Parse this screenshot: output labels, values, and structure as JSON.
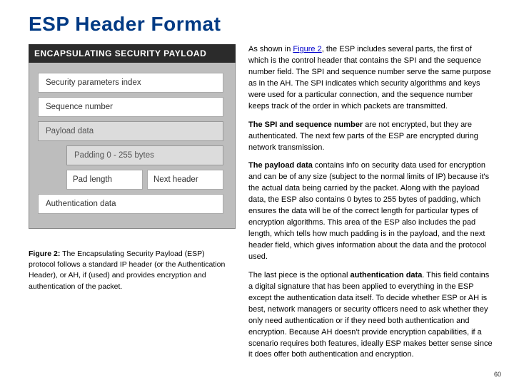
{
  "title": "ESP Header Format",
  "diagram": {
    "title": "ENCAPSULATING SECURITY PAYLOAD",
    "fields": {
      "spi": "Security parameters index",
      "seq": "Sequence number",
      "payload": "Payload data",
      "padding": "Padding 0 - 255 bytes",
      "padlen": "Pad length",
      "nexthdr": "Next header",
      "auth": "Authentication data"
    }
  },
  "caption": {
    "label": "Figure 2:",
    "text": " The Encapsulating Security Payload (ESP) protocol follows a standard IP header (or the Authentication Header), or AH, if (used) and provides encryption and authentication of the packet."
  },
  "paragraphs": {
    "p1_a": "As shown in ",
    "p1_link": "Figure 2",
    "p1_b": ", the ESP includes several parts, the first of which is the control header that contains the SPI and the sequence number field. The SPI and sequence number serve the same purpose as in the AH. The SPI indicates which security algorithms and keys were used for a particular connection, and the sequence number keeps track of the order in which packets are transmitted.",
    "p2_b": "The SPI and sequence number",
    "p2": " are not encrypted, but they are authenticated. The next few parts of the ESP are encrypted during network transmission.",
    "p3_b": "The payload data",
    "p3": " contains info on security data used for encryption and can be of any size (subject to the normal limits of IP) because it's the actual data being carried by the packet. Along with the payload data, the ESP also contains 0 bytes to 255 bytes of padding, which ensures the data will be of the correct length for particular types of encryption algorithms. This area of the ESP also includes the pad length, which tells how much padding is in the payload, and the next header field, which gives information about the data and the protocol used.",
    "p4_a": "The last piece is the optional ",
    "p4_b": "authentication data",
    "p4_c": ". This field contains a digital signature that has been applied to everything in the ESP except the authentication data itself. To decide whether ESP or AH is best, network managers or security officers need to ask whether they only need authentication or if they need both authentication and encryption. Because AH doesn't provide encryption capabilities, if a scenario requires both features, ideally ESP makes better sense since it does offer both authentication and encryption."
  },
  "page_number": "60"
}
